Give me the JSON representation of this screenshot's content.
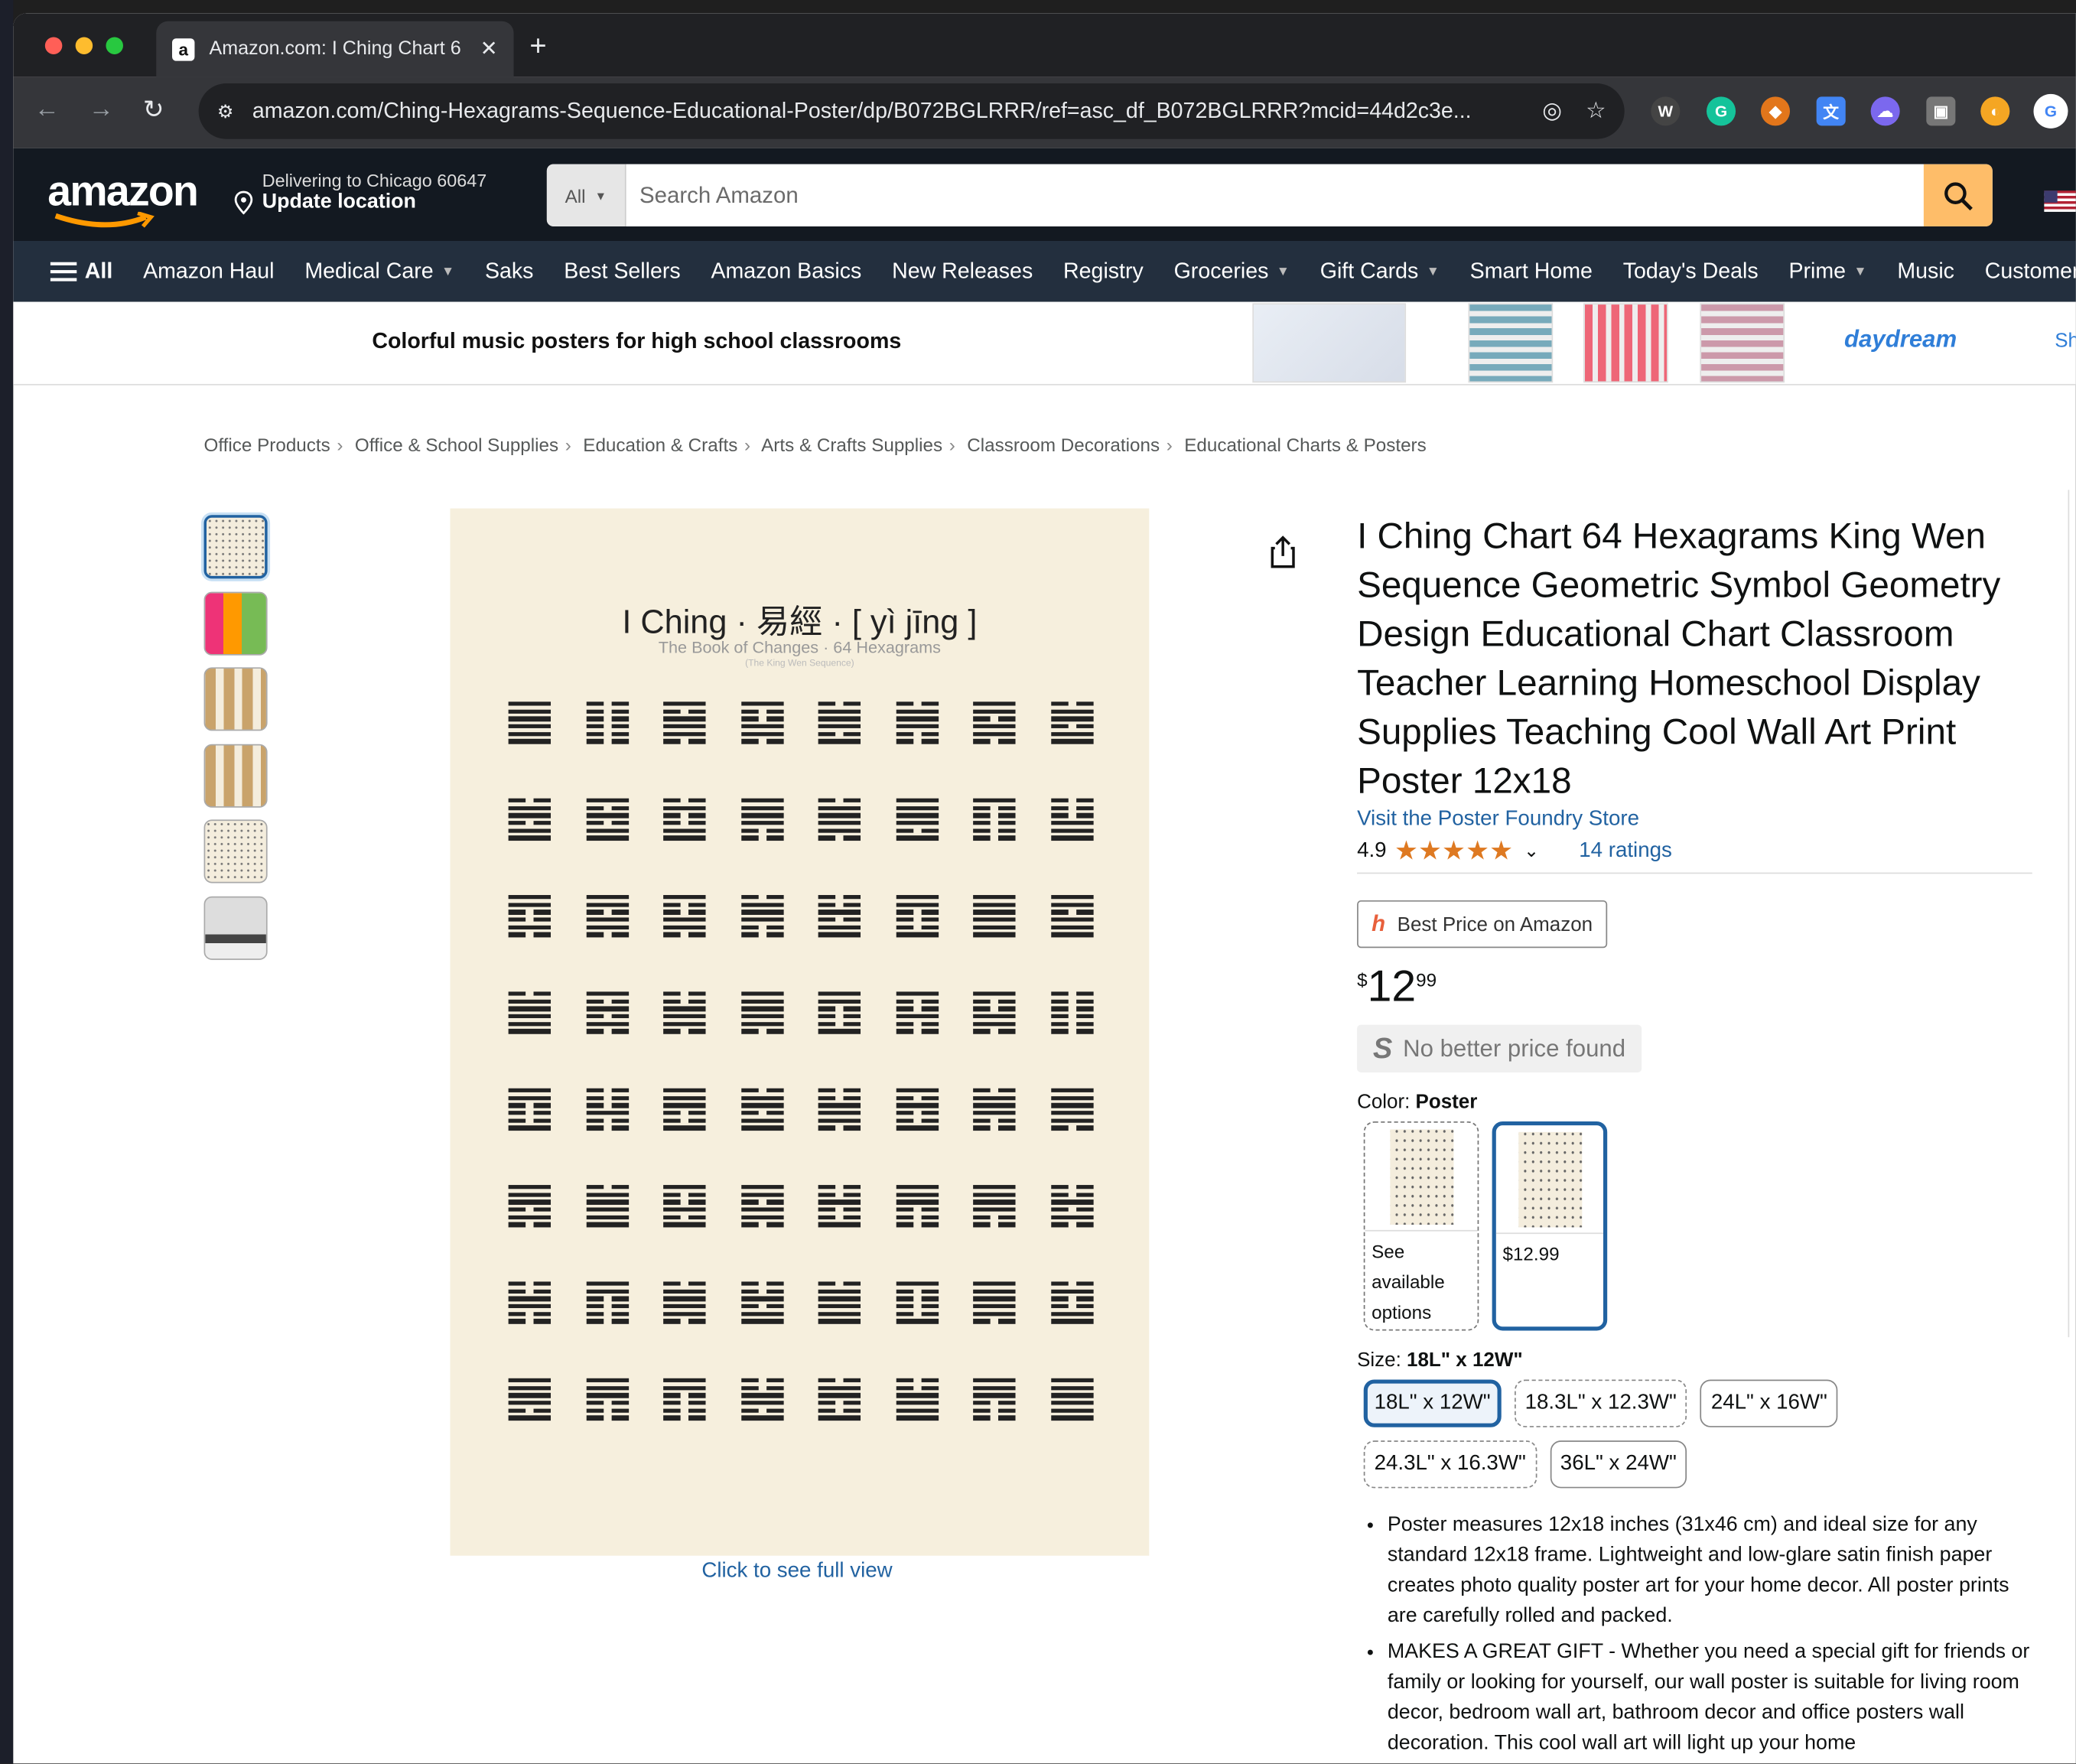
{
  "browser": {
    "tab_title": "Amazon.com: I Ching Chart 6",
    "tab_favicon": "a",
    "url": "amazon.com/Ching-Hexagrams-Sequence-Educational-Poster/dp/B072BGLRRR/ref=asc_df_B072BGLRRR?mcid=44d2c3e..."
  },
  "header": {
    "logo": "amazon",
    "deliver_line1": "Delivering to Chicago 60647",
    "deliver_line2": "Update location",
    "search_category": "All",
    "search_placeholder": "Search Amazon"
  },
  "nav": {
    "all_label": "All",
    "items": [
      "Amazon Haul",
      "Medical Care",
      "Saks",
      "Best Sellers",
      "Amazon Basics",
      "New Releases",
      "Registry",
      "Groceries",
      "Gift Cards",
      "Smart Home",
      "Today's Deals",
      "Prime",
      "Music",
      "Customer Service"
    ]
  },
  "promo": {
    "text": "Colorful music posters for high school classrooms",
    "brand": "daydream",
    "shop": "Sh"
  },
  "breadcrumbs": [
    "Office Products",
    "Office & School Supplies",
    "Education & Crafts",
    "Arts & Crafts Supplies",
    "Classroom Decorations",
    "Educational Charts & Posters"
  ],
  "poster": {
    "title": "I Ching · 易經 · [ yì jīng ]",
    "subtitle": "The Book of Changes · 64 Hexagrams",
    "subtitle2": "(The King Wen Sequence)"
  },
  "gallery": {
    "full_view": "Click to see full view"
  },
  "product": {
    "title": "I Ching Chart 64 Hexagrams King Wen Sequence Geometric Symbol Geometry Design Educational Chart Classroom Teacher Learning Homeschool Display Supplies Teaching Cool Wall Art Print Poster 12x18",
    "store": "Visit the Poster Foundry Store",
    "rating": "4.9",
    "ratings_count": "14 ratings",
    "best_price_button": "Best Price on Amazon",
    "price_symbol": "$",
    "price_whole": "12",
    "price_fraction": "99",
    "no_better": "No better price found",
    "color_label": "Color:",
    "color_value": "Poster",
    "swatch1_text": "See available options",
    "swatch2_text": "$12.99",
    "size_label": "Size:",
    "size_value": "18L\" x 12W\"",
    "sizes": [
      "18L\" x 12W\"",
      "18.3L\" x 12.3W\"",
      "24L\" x 16W\"",
      "24.3L\" x 16.3W\"",
      "36L\" x 24W\""
    ],
    "bullets": [
      "Poster measures 12x18 inches (31x46 cm) and ideal size for any standard 12x18 frame. Lightweight and low-glare satin finish paper creates photo quality poster art for your home decor. All poster prints are carefully rolled and packed.",
      "MAKES A GREAT GIFT - Whether you need a special gift for friends or family or looking for yourself, our wall poster is suitable for living room decor, bedroom wall art, bathroom decor and office posters wall decoration. This cool wall art will light up your home"
    ]
  },
  "colors": {
    "amazon_dark": "#131921",
    "amazon_nav": "#232f3e",
    "search_button": "#febd69",
    "link": "#2162a1",
    "star": "#de7921"
  }
}
